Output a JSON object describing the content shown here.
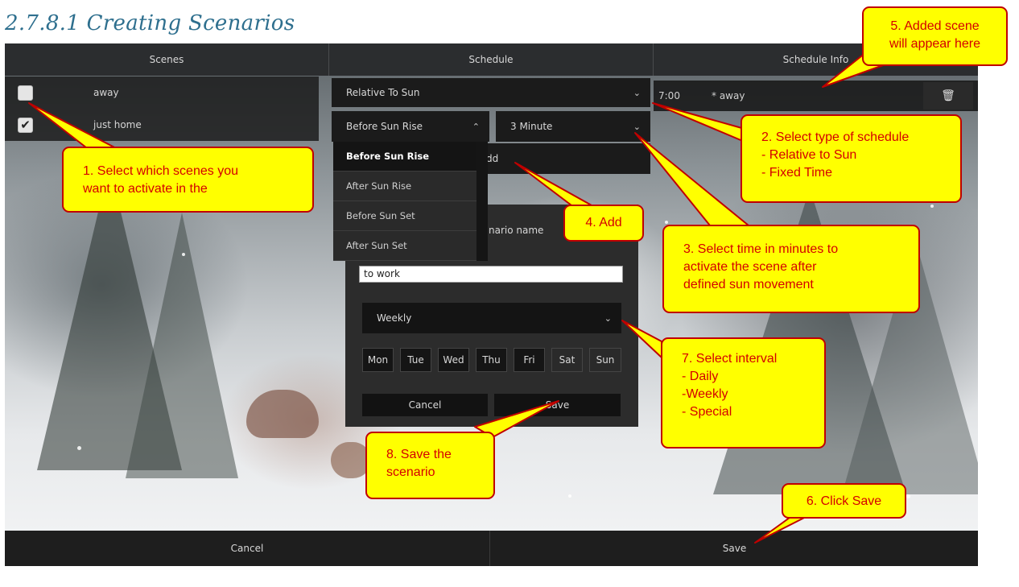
{
  "doc": {
    "heading": "2.7.8.1 Creating Scenarios"
  },
  "columns": {
    "scenes": "Scenes",
    "schedule": "Schedule",
    "info": "Schedule Info"
  },
  "scenes": [
    {
      "label": "away",
      "checked": false
    },
    {
      "label": "just home",
      "checked": true
    }
  ],
  "schedule": {
    "type": "Relative To Sun",
    "sun_event": "Before Sun Rise",
    "minutes": "3 Minute",
    "add_label": "dd",
    "sun_options": [
      "Before Sun Rise",
      "After Sun Rise",
      "Before Sun Set",
      "After Sun Set"
    ]
  },
  "dialog": {
    "title_fragment": "nario name",
    "scenario_name": "to work",
    "interval": "Weekly",
    "days": [
      "Mon",
      "Tue",
      "Wed",
      "Thu",
      "Fri",
      "Sat",
      "Sun"
    ],
    "cancel": "Cancel",
    "save": "Save"
  },
  "info": {
    "time": "7:00",
    "scene": "* away"
  },
  "bottom": {
    "cancel": "Cancel",
    "save": "Save"
  },
  "callouts": {
    "c1": [
      "1. Select which scenes you",
      "want to activate in the"
    ],
    "c2": [
      "2. Select type of schedule",
      "- Relative to Sun",
      "- Fixed Time"
    ],
    "c3": [
      "3. Select time in minutes to",
      "activate the scene after",
      "defined sun movement"
    ],
    "c4": [
      "4. Add"
    ],
    "c5": [
      "5. Added scene",
      "will appear here"
    ],
    "c6": [
      "6. Click Save"
    ],
    "c7": [
      "7. Select interval",
      "- Daily",
      "-Weekly",
      "- Special"
    ],
    "c8": [
      "8. Save the",
      "scenario"
    ]
  },
  "colors": {
    "callout_fill": "#ffff00",
    "callout_border": "#c00000",
    "callout_text": "#d40000",
    "heading": "#2e6f8e"
  }
}
